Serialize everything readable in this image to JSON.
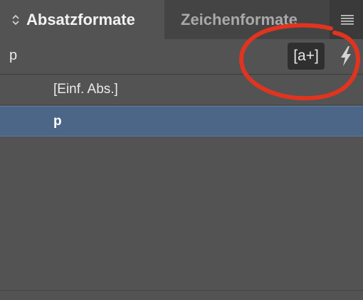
{
  "tabs": [
    {
      "label": "Absatzformate",
      "active": true
    },
    {
      "label": "Zeichenformate",
      "active": false
    }
  ],
  "toolbar": {
    "current_style": "p",
    "new_style_label": "[a+]"
  },
  "styles": [
    {
      "label": "[Einf. Abs.]",
      "selected": false
    },
    {
      "label": "p",
      "selected": true
    }
  ],
  "icons": {
    "collapse": "chevron-updown-icon",
    "menu": "hamburger-menu-icon",
    "quick_apply": "lightning-icon"
  },
  "colors": {
    "selection": "#4c6687",
    "annotation": "#e0341f"
  }
}
